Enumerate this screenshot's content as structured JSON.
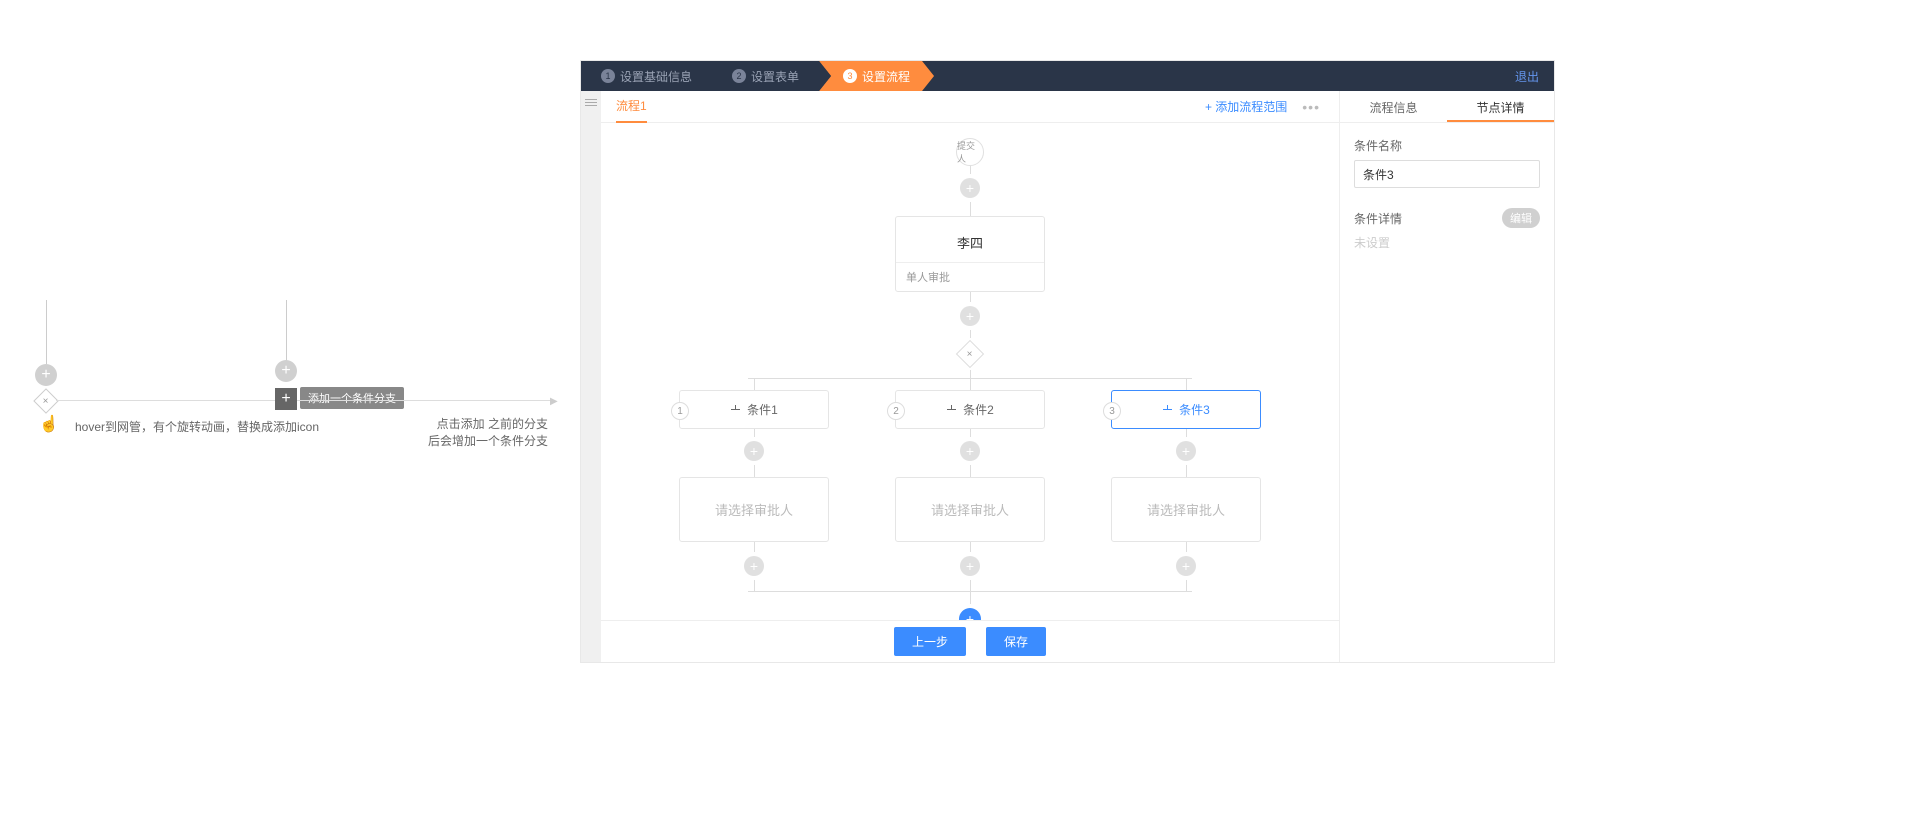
{
  "left_annotations": {
    "hover_text": "hover到网管，有个旋转动画，替换成添加icon",
    "click_text_line1": "点击添加 之前的分支",
    "click_text_line2": "后会增加一个条件分支",
    "tooltip": "添加一个条件分支"
  },
  "stepper": {
    "steps": [
      {
        "num": "1",
        "label": "设置基础信息"
      },
      {
        "num": "2",
        "label": "设置表单"
      },
      {
        "num": "3",
        "label": "设置流程"
      }
    ],
    "exit": "退出"
  },
  "canvas": {
    "tab": "流程1",
    "add_scope": "+ 添加流程范围",
    "more": "•••",
    "start_node": "提交人",
    "approver": {
      "name": "李四",
      "type": "单人审批"
    },
    "branches": [
      {
        "num": "1",
        "cond": "条件1",
        "approver": "请选择审批人"
      },
      {
        "num": "2",
        "cond": "条件2",
        "approver": "请选择审批人"
      },
      {
        "num": "3",
        "cond": "条件3",
        "approver": "请选择审批人"
      }
    ]
  },
  "panel": {
    "tabs": {
      "info": "流程信息",
      "detail": "节点详情"
    },
    "name_label": "条件名称",
    "name_value": "条件3",
    "detail_label": "条件详情",
    "edit": "编辑",
    "unset": "未设置"
  },
  "footer": {
    "prev": "上一步",
    "save": "保存"
  }
}
